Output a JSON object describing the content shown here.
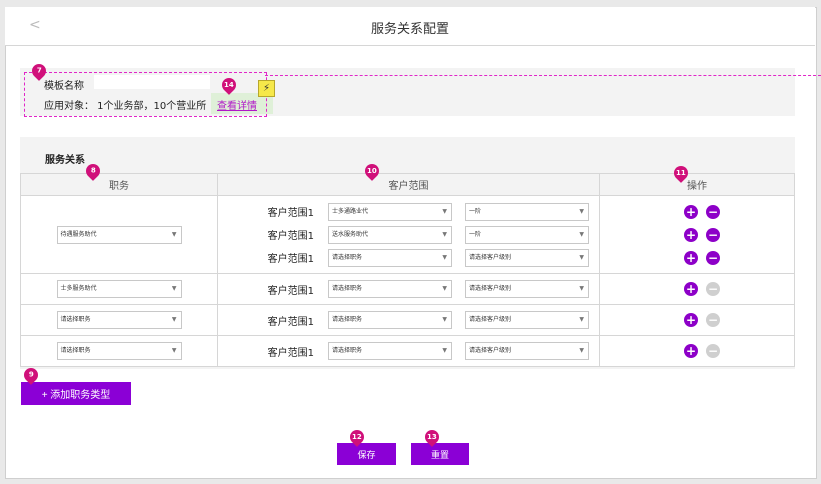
{
  "header": {
    "title": "服务关系配置",
    "back": "<"
  },
  "template": {
    "name_label": "模板名称",
    "apply_text": "应用对象：  1个业务部，10个营业所",
    "detail_link": "查看详情"
  },
  "relation": {
    "section_title": "服务关系",
    "columns": {
      "job": "职务",
      "customer": "客户范围",
      "ops": "操作"
    },
    "rows": [
      {
        "job": "待遇服务助代",
        "ranges": [
          {
            "label": "客户范围1",
            "a": "士多通路业代",
            "b": "一阶"
          },
          {
            "label": "客户范围1",
            "a": "送水服务助代",
            "b": "一阶"
          },
          {
            "label": "客户范围1",
            "a": "请选择职务",
            "b": "请选择客户级别"
          }
        ]
      },
      {
        "job": "士多服务助代",
        "ranges": [
          {
            "label": "客户范围1",
            "a": "请选择职务",
            "b": "请选择客户级别"
          }
        ]
      },
      {
        "job": "请选择职务",
        "ranges": [
          {
            "label": "客户范围1",
            "a": "请选择职务",
            "b": "请选择客户级别"
          }
        ]
      },
      {
        "job": "请选择职务",
        "ranges": [
          {
            "label": "客户范围1",
            "a": "请选择职务",
            "b": "请选择客户级别"
          }
        ]
      }
    ],
    "add_button": "+ 添加职务类型"
  },
  "actions": {
    "save": "保存",
    "reset": "重置"
  },
  "badges": [
    "7",
    "14",
    "8",
    "10",
    "11",
    "9",
    "12",
    "13"
  ],
  "colors": {
    "accent": "#8b00d6",
    "badge": "#d0107a",
    "dashed": "#e026c8"
  }
}
